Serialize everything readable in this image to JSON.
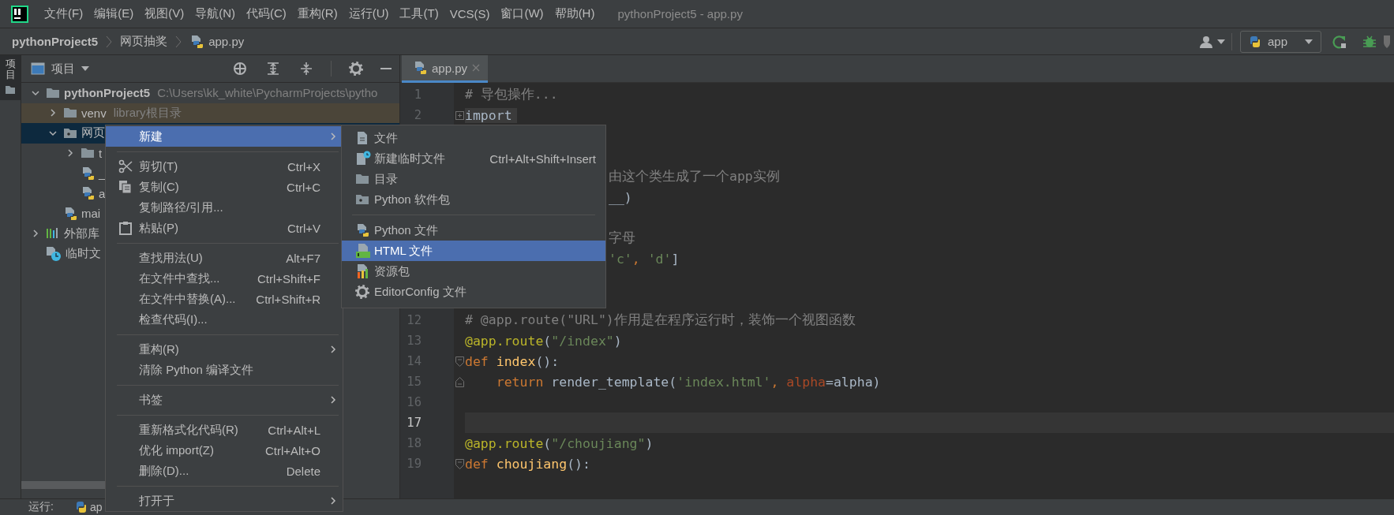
{
  "menubar": {
    "items": [
      "文件(F)",
      "编辑(E)",
      "视图(V)",
      "导航(N)",
      "代码(C)",
      "重构(R)",
      "运行(U)",
      "工具(T)",
      "VCS(S)",
      "窗口(W)",
      "帮助(H)"
    ],
    "title": "pythonProject5 - app.py"
  },
  "navbar": {
    "breadcrumbs": [
      {
        "label": "pythonProject5",
        "kind": "project"
      },
      {
        "label": "网页抽奖",
        "kind": "folder"
      },
      {
        "label": "app.py",
        "kind": "python-file"
      }
    ],
    "run_config": "app"
  },
  "side_strip": {
    "tab": "项目",
    "selected": true
  },
  "project_panel": {
    "title": "项目",
    "tree": [
      {
        "label": "pythonProject5",
        "kind": "project",
        "note": "C:\\Users\\kk_white\\PycharmProjects\\pytho",
        "expanded": true,
        "selected": false,
        "excluded": false,
        "children": [
          {
            "label": "venv",
            "kind": "folder",
            "note": "library根目录",
            "expanded": false,
            "selected": false,
            "excluded": true
          },
          {
            "label": "网页",
            "kind": "package",
            "expanded": true,
            "selected": true,
            "excluded": false,
            "children": [
              {
                "label": "t",
                "kind": "folder",
                "expanded": false,
                "selected": false,
                "excluded": false
              },
              {
                "label": "_",
                "kind": "python-file",
                "selected": false,
                "excluded": false
              },
              {
                "label": "a",
                "kind": "python-file",
                "selected": false,
                "excluded": false
              }
            ]
          },
          {
            "label": "mai",
            "kind": "python-file",
            "selected": false,
            "excluded": false
          }
        ]
      },
      {
        "label": "外部库",
        "kind": "library",
        "expanded": false,
        "selected": false,
        "excluded": false
      },
      {
        "label": "临时文",
        "kind": "scratch",
        "selected": false,
        "excluded": false
      }
    ]
  },
  "editor": {
    "tabs": [
      {
        "label": "app.py",
        "selected": true
      }
    ],
    "lines": [
      {
        "kind": "text",
        "number": "1",
        "current": false,
        "tokens": [
          {
            "kind": "comment",
            "text": "# 导包操作..."
          }
        ]
      },
      {
        "kind": "text",
        "number": "2",
        "current": false,
        "folded": true,
        "tokens": [
          {
            "kind": "folded",
            "text": "import"
          }
        ]
      },
      {
        "kind": "covered"
      },
      {
        "kind": "covered"
      },
      {
        "kind": "tail",
        "tokens": [
          {
            "kind": "comment",
            "text": "由这个类生成了一个app实例"
          }
        ]
      },
      {
        "kind": "tail",
        "tokens": [
          {
            "kind": "plain",
            "text": "__)"
          }
        ]
      },
      {
        "kind": "covered"
      },
      {
        "kind": "tail",
        "tokens": [
          {
            "kind": "comment",
            "text": "字母"
          }
        ]
      },
      {
        "kind": "tail",
        "tokens": [
          {
            "kind": "string",
            "text": "'c'"
          },
          {
            "kind": "comma",
            "text": ","
          },
          {
            "kind": "string",
            "text": " 'd'"
          },
          {
            "kind": "plain",
            "text": "]"
          }
        ]
      },
      {
        "kind": "covered"
      },
      {
        "kind": "covered"
      },
      {
        "kind": "text",
        "number": "12",
        "current": false,
        "tokens": [
          {
            "kind": "comment",
            "text": "# @app.route(\"URL\")作用是在程序运行时，装饰一个视图函数"
          }
        ]
      },
      {
        "kind": "text",
        "number": "13",
        "current": false,
        "tokens": [
          {
            "kind": "decorator",
            "text": "@app.route"
          },
          {
            "kind": "plain",
            "text": "("
          },
          {
            "kind": "string",
            "text": "\"/index\""
          },
          {
            "kind": "plain",
            "text": ")"
          }
        ]
      },
      {
        "kind": "text",
        "number": "14",
        "current": false,
        "folded": false,
        "tokens": [
          {
            "kind": "keyword",
            "text": "def "
          },
          {
            "kind": "function",
            "text": "index"
          },
          {
            "kind": "plain",
            "text": "():"
          }
        ]
      },
      {
        "kind": "text",
        "number": "15",
        "current": false,
        "fold_end": true,
        "tokens": [
          {
            "kind": "keyword",
            "text": "    return"
          },
          {
            "kind": "plain",
            "text": " render_template("
          },
          {
            "kind": "string",
            "text": "'index.html'"
          },
          {
            "kind": "comma",
            "text": ","
          },
          {
            "kind": "param",
            "text": " alpha"
          },
          {
            "kind": "plain",
            "text": "=alpha)"
          }
        ]
      },
      {
        "kind": "text",
        "number": "16",
        "current": false
      },
      {
        "kind": "text",
        "number": "17",
        "current": true
      },
      {
        "kind": "text",
        "number": "18",
        "current": false,
        "tokens": [
          {
            "kind": "decorator",
            "text": "@app.route"
          },
          {
            "kind": "plain",
            "text": "("
          },
          {
            "kind": "string",
            "text": "\"/choujiang\""
          },
          {
            "kind": "plain",
            "text": ")"
          }
        ]
      },
      {
        "kind": "text",
        "number": "19",
        "current": false,
        "folded": false,
        "tokens": [
          {
            "kind": "keyword",
            "text": "def "
          },
          {
            "kind": "function",
            "text": "choujiang"
          },
          {
            "kind": "plain",
            "text": "():"
          }
        ]
      }
    ]
  },
  "context_menu": {
    "items": [
      {
        "kind": "item",
        "label": "新建",
        "submenu": true,
        "selected": true
      },
      {
        "kind": "separator"
      },
      {
        "kind": "cut",
        "label": "剪切(T)",
        "shortcut": "Ctrl+X",
        "submenu": false,
        "selected": false
      },
      {
        "kind": "copy",
        "label": "复制(C)",
        "shortcut": "Ctrl+C",
        "submenu": false,
        "selected": false
      },
      {
        "kind": "item",
        "label": "复制路径/引用...",
        "submenu": false,
        "selected": false
      },
      {
        "kind": "paste",
        "label": "粘贴(P)",
        "shortcut": "Ctrl+V",
        "submenu": false,
        "selected": false
      },
      {
        "kind": "separator"
      },
      {
        "kind": "item",
        "label": "查找用法(U)",
        "shortcut": "Alt+F7",
        "submenu": false,
        "selected": false
      },
      {
        "kind": "item",
        "label": "在文件中查找...",
        "shortcut": "Ctrl+Shift+F",
        "submenu": false,
        "selected": false
      },
      {
        "kind": "item",
        "label": "在文件中替换(A)...",
        "shortcut": "Ctrl+Shift+R",
        "submenu": false,
        "selected": false
      },
      {
        "kind": "item",
        "label": "检查代码(I)...",
        "submenu": false,
        "selected": false
      },
      {
        "kind": "separator"
      },
      {
        "kind": "item",
        "label": "重构(R)",
        "submenu": true,
        "selected": false
      },
      {
        "kind": "item",
        "label": "清除 Python 编译文件",
        "submenu": false,
        "selected": false
      },
      {
        "kind": "separator"
      },
      {
        "kind": "item",
        "label": "书签",
        "submenu": true,
        "selected": false
      },
      {
        "kind": "separator"
      },
      {
        "kind": "item",
        "label": "重新格式化代码(R)",
        "shortcut": "Ctrl+Alt+L",
        "submenu": false,
        "selected": false
      },
      {
        "kind": "item",
        "label": "优化 import(Z)",
        "shortcut": "Ctrl+Alt+O",
        "submenu": false,
        "selected": false
      },
      {
        "kind": "item",
        "label": "删除(D)...",
        "shortcut": "Delete",
        "submenu": false,
        "selected": false
      },
      {
        "kind": "separator"
      },
      {
        "kind": "item",
        "label": "打开于",
        "submenu": true,
        "selected": false
      }
    ]
  },
  "submenu": {
    "items": [
      {
        "kind": "file",
        "label": "文件",
        "selected": false
      },
      {
        "kind": "scratch-file",
        "label": "新建临时文件",
        "shortcut": "Ctrl+Alt+Shift+Insert",
        "selected": false
      },
      {
        "kind": "directory",
        "label": "目录",
        "selected": false
      },
      {
        "kind": "package",
        "label": "Python 软件包",
        "selected": false
      },
      {
        "kind": "separator"
      },
      {
        "kind": "python-file",
        "label": "Python 文件",
        "selected": false
      },
      {
        "kind": "html-file",
        "label": "HTML 文件",
        "selected": true
      },
      {
        "kind": "resource-bundle",
        "label": "资源包",
        "selected": false
      },
      {
        "kind": "editorconfig",
        "label": "EditorConfig 文件",
        "selected": false
      }
    ]
  },
  "run_bar": {
    "label": "运行:",
    "config": "ap"
  }
}
